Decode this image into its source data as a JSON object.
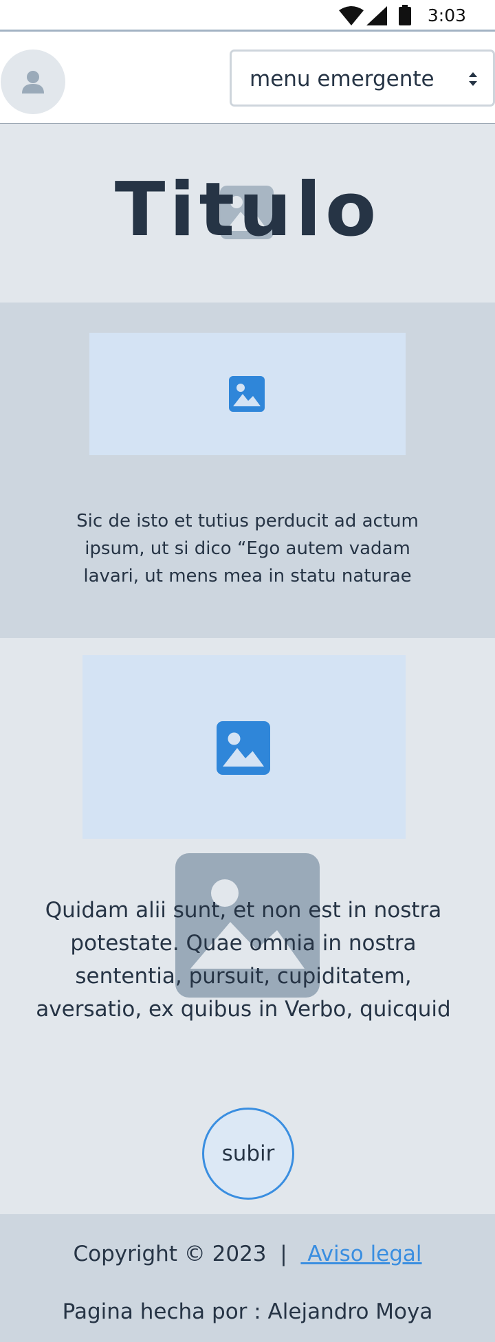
{
  "status_bar": {
    "time": "3:03",
    "icons": [
      "wifi-icon",
      "cellular-signal-icon",
      "battery-icon"
    ]
  },
  "header": {
    "avatar_icon": "user-icon",
    "menu_select": {
      "selected": "menu emergente",
      "icon": "chevron-up-down-icon"
    }
  },
  "hero": {
    "title": "Titulo",
    "background_icon": "image-placeholder-icon"
  },
  "section1": {
    "image_icon": "image-icon",
    "text": "Sic de isto et tutius perducit ad actum ipsum, ut si dico “Ego autem vadam lavari, ut mens mea in statu naturae"
  },
  "section2": {
    "image_icon": "image-icon",
    "overlay_icon": "image-placeholder-icon",
    "text": "Quidam alii sunt, et non est in nostra potestate. Quae omnia in nostra sententia, pursuit, cupiditatem, aversatio, ex quibus in Verbo, quicquid",
    "button_label": "subir"
  },
  "footer": {
    "copyright": "Copyright © 2023  |  ",
    "legal_link": " Aviso legal",
    "author": "Pagina hecha por : Alejandro Moya"
  },
  "colors": {
    "text": "#263445",
    "accent": "#3a8ee0",
    "section_light": "#e2e7ec",
    "section_dark": "#cdd6df",
    "image_box": "#d4e3f4"
  }
}
